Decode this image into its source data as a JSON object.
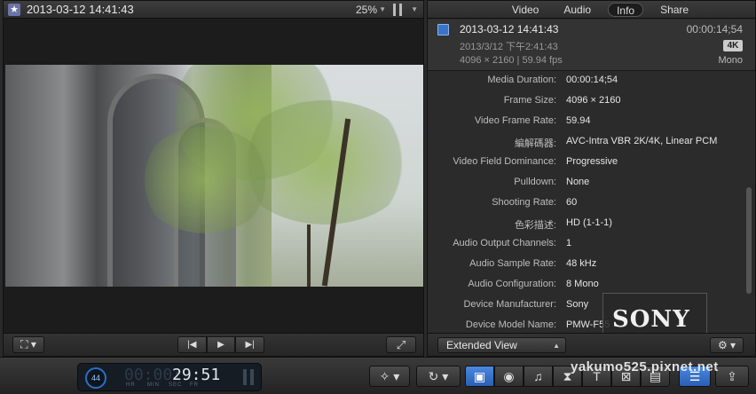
{
  "viewer": {
    "clip_title": "2013-03-12 14:41:43",
    "zoom": "25%",
    "icons": {
      "favorite": "star-icon",
      "transform": "transform-icon",
      "skip_back": "skip-back-icon",
      "play": "play-icon",
      "skip_forward": "skip-forward-icon",
      "fullscreen": "fullscreen-icon"
    }
  },
  "inspector": {
    "tabs": [
      {
        "label": "Video",
        "active": false
      },
      {
        "label": "Audio",
        "active": false
      },
      {
        "label": "Info",
        "active": true
      },
      {
        "label": "Share",
        "active": false
      }
    ],
    "summary": {
      "title": "2013-03-12 14:41:43",
      "duration": "00:00:14;54",
      "date": "2013/3/12 下午2:41:43",
      "badge": "4K",
      "format": "4096 × 2160 | 59.94 fps",
      "audio": "Mono"
    },
    "properties": [
      {
        "label": "Media Duration:",
        "value": "00:00:14;54"
      },
      {
        "label": "Frame Size:",
        "value": "4096 × 2160"
      },
      {
        "label": "Video Frame Rate:",
        "value": "59.94"
      },
      {
        "label": "編解碼器:",
        "value": "AVC-Intra VBR 2K/4K, Linear PCM"
      },
      {
        "label": "Video Field Dominance:",
        "value": "Progressive"
      },
      {
        "label": "Pulldown:",
        "value": "None"
      },
      {
        "label": "Shooting Rate:",
        "value": "60"
      },
      {
        "label": "色彩描述:",
        "value": "HD (1-1-1)"
      },
      {
        "label": "Audio Output Channels:",
        "value": "1"
      },
      {
        "label": "Audio Sample Rate:",
        "value": "48 kHz"
      },
      {
        "label": "Audio Configuration:",
        "value": "8 Mono"
      },
      {
        "label": "Device Manufacturer:",
        "value": "Sony"
      },
      {
        "label": "Device Model Name:",
        "value": "PMW-F55"
      }
    ],
    "view_select": "Extended View",
    "sony_logo": "SONY",
    "icons": {
      "clip": "film-icon",
      "settings": "gear-icon"
    }
  },
  "toolbar": {
    "progress": "44",
    "timecode_dim": "00:00:",
    "timecode_bright": "29:51",
    "timecode_units": [
      "HR",
      "MIN",
      "SEC",
      "FR"
    ],
    "watermark": "yakumo525.pixnet.net",
    "icons": [
      "magic-wand-icon",
      "retime-icon",
      "photo-video-icon",
      "camera-icon",
      "music-icon",
      "transitions-icon",
      "titles-icon",
      "generators-icon",
      "themes-icon",
      "background-tasks-icon",
      "share-icon"
    ]
  },
  "colors": {
    "accent": "#2c6fc6",
    "panel": "#2b2b2b",
    "viewer_bg": "#1c1c1c"
  }
}
